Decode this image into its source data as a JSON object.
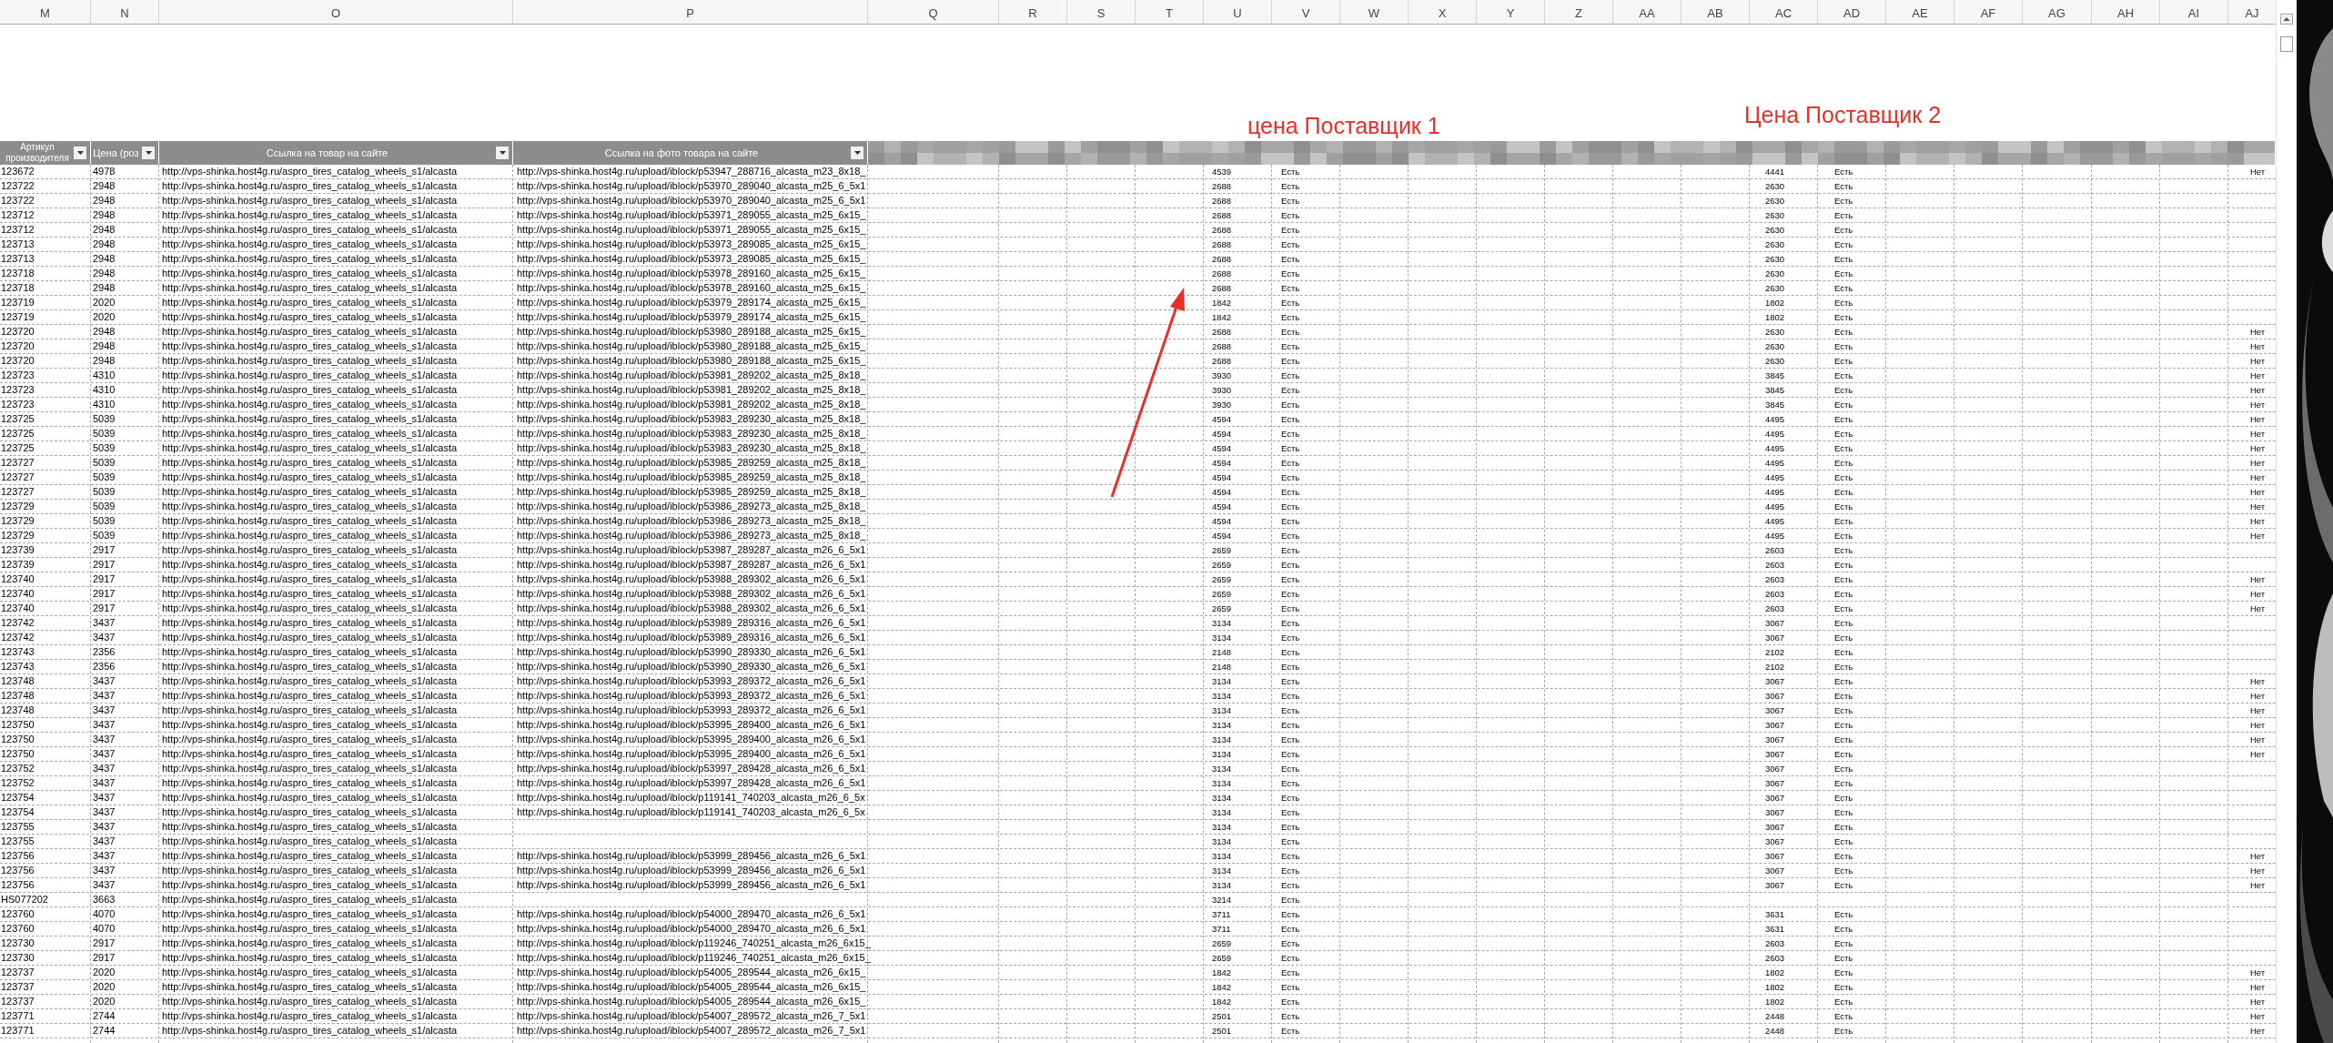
{
  "column_letters": [
    "M",
    "N",
    "O",
    "P",
    "Q",
    "R",
    "S",
    "T",
    "U",
    "V",
    "W",
    "X",
    "Y",
    "Z",
    "AA",
    "AB",
    "AC",
    "AD",
    "AE",
    "AF",
    "AG",
    "AH",
    "AI",
    "AJ"
  ],
  "annotations": [
    {
      "text": "цена Поставщик 1"
    },
    {
      "text": "Цена Поставщик 2"
    }
  ],
  "column_headers": [
    {
      "label": "Артикул производителя"
    },
    {
      "label": "Цена (роз"
    },
    {
      "label": "Ссылка на товар на сайте"
    },
    {
      "label": "Ссылка на фото товара на сайте"
    }
  ],
  "rows": [
    {
      "article": "123672",
      "retail_price": "4978",
      "product_url": "http://vps-shinka.host4g.ru/aspro_tires_catalog_wheels_s1/alcasta",
      "photo_url": "http://vps-shinka.host4g.ru/upload/iblock/p53947_288716_alcasta_m23_8x18_",
      "supplier1_price": "4539",
      "supplier1_stock": "Есть",
      "supplier2_price": "4441",
      "supplier2_stock": "Есть",
      "column_aj": "Нет"
    },
    {
      "article": "123722",
      "retail_price": "2948",
      "product_url": "http://vps-shinka.host4g.ru/aspro_tires_catalog_wheels_s1/alcasta",
      "photo_url": "http://vps-shinka.host4g.ru/upload/iblock/p53970_289040_alcasta_m25_6_5x1",
      "supplier1_price": "2688",
      "supplier1_stock": "Есть",
      "supplier2_price": "2630",
      "supplier2_stock": "Есть"
    },
    {
      "article": "123722",
      "retail_price": "2948",
      "product_url": "http://vps-shinka.host4g.ru/aspro_tires_catalog_wheels_s1/alcasta",
      "photo_url": "http://vps-shinka.host4g.ru/upload/iblock/p53970_289040_alcasta_m25_6_5x1",
      "supplier1_price": "2688",
      "supplier1_stock": "Есть",
      "supplier2_price": "2630",
      "supplier2_stock": "Есть"
    },
    {
      "article": "123712",
      "retail_price": "2948",
      "product_url": "http://vps-shinka.host4g.ru/aspro_tires_catalog_wheels_s1/alcasta",
      "photo_url": "http://vps-shinka.host4g.ru/upload/iblock/p53971_289055_alcasta_m25_6x15_",
      "supplier1_price": "2688",
      "supplier1_stock": "Есть",
      "supplier2_price": "2630",
      "supplier2_stock": "Есть"
    },
    {
      "article": "123712",
      "retail_price": "2948",
      "product_url": "http://vps-shinka.host4g.ru/aspro_tires_catalog_wheels_s1/alcasta",
      "photo_url": "http://vps-shinka.host4g.ru/upload/iblock/p53971_289055_alcasta_m25_6x15_",
      "supplier1_price": "2688",
      "supplier1_stock": "Есть",
      "supplier2_price": "2630",
      "supplier2_stock": "Есть"
    },
    {
      "article": "123713",
      "retail_price": "2948",
      "product_url": "http://vps-shinka.host4g.ru/aspro_tires_catalog_wheels_s1/alcasta",
      "photo_url": "http://vps-shinka.host4g.ru/upload/iblock/p53973_289085_alcasta_m25_6x15_",
      "supplier1_price": "2688",
      "supplier1_stock": "Есть",
      "supplier2_price": "2630",
      "supplier2_stock": "Есть"
    },
    {
      "article": "123713",
      "retail_price": "2948",
      "product_url": "http://vps-shinka.host4g.ru/aspro_tires_catalog_wheels_s1/alcasta",
      "photo_url": "http://vps-shinka.host4g.ru/upload/iblock/p53973_289085_alcasta_m25_6x15_",
      "supplier1_price": "2688",
      "supplier1_stock": "Есть",
      "supplier2_price": "2630",
      "supplier2_stock": "Есть"
    },
    {
      "article": "123718",
      "retail_price": "2948",
      "product_url": "http://vps-shinka.host4g.ru/aspro_tires_catalog_wheels_s1/alcasta",
      "photo_url": "http://vps-shinka.host4g.ru/upload/iblock/p53978_289160_alcasta_m25_6x15_",
      "supplier1_price": "2688",
      "supplier1_stock": "Есть",
      "supplier2_price": "2630",
      "supplier2_stock": "Есть"
    },
    {
      "article": "123718",
      "retail_price": "2948",
      "product_url": "http://vps-shinka.host4g.ru/aspro_tires_catalog_wheels_s1/alcasta",
      "photo_url": "http://vps-shinka.host4g.ru/upload/iblock/p53978_289160_alcasta_m25_6x15_",
      "supplier1_price": "2688",
      "supplier1_stock": "Есть",
      "supplier2_price": "2630",
      "supplier2_stock": "Есть"
    },
    {
      "article": "123719",
      "retail_price": "2020",
      "product_url": "http://vps-shinka.host4g.ru/aspro_tires_catalog_wheels_s1/alcasta",
      "photo_url": "http://vps-shinka.host4g.ru/upload/iblock/p53979_289174_alcasta_m25_6x15_",
      "supplier1_price": "1842",
      "supplier1_stock": "Есть",
      "supplier2_price": "1802",
      "supplier2_stock": "Есть"
    },
    {
      "article": "123719",
      "retail_price": "2020",
      "product_url": "http://vps-shinka.host4g.ru/aspro_tires_catalog_wheels_s1/alcasta",
      "photo_url": "http://vps-shinka.host4g.ru/upload/iblock/p53979_289174_alcasta_m25_6x15_",
      "supplier1_price": "1842",
      "supplier1_stock": "Есть",
      "supplier2_price": "1802",
      "supplier2_stock": "Есть"
    },
    {
      "article": "123720",
      "retail_price": "2948",
      "product_url": "http://vps-shinka.host4g.ru/aspro_tires_catalog_wheels_s1/alcasta",
      "photo_url": "http://vps-shinka.host4g.ru/upload/iblock/p53980_289188_alcasta_m25_6x15_",
      "supplier1_price": "2688",
      "supplier1_stock": "Есть",
      "supplier2_price": "2630",
      "supplier2_stock": "Есть",
      "column_aj": "Нет"
    },
    {
      "article": "123720",
      "retail_price": "2948",
      "product_url": "http://vps-shinka.host4g.ru/aspro_tires_catalog_wheels_s1/alcasta",
      "photo_url": "http://vps-shinka.host4g.ru/upload/iblock/p53980_289188_alcasta_m25_6x15_",
      "supplier1_price": "2688",
      "supplier1_stock": "Есть",
      "supplier2_price": "2630",
      "supplier2_stock": "Есть",
      "column_aj": "Нет"
    },
    {
      "article": "123720",
      "retail_price": "2948",
      "product_url": "http://vps-shinka.host4g.ru/aspro_tires_catalog_wheels_s1/alcasta",
      "photo_url": "http://vps-shinka.host4g.ru/upload/iblock/p53980_289188_alcasta_m25_6x15_",
      "supplier1_price": "2688",
      "supplier1_stock": "Есть",
      "supplier2_price": "2630",
      "supplier2_stock": "Есть",
      "column_aj": "Нет"
    },
    {
      "article": "123723",
      "retail_price": "4310",
      "product_url": "http://vps-shinka.host4g.ru/aspro_tires_catalog_wheels_s1/alcasta",
      "photo_url": "http://vps-shinka.host4g.ru/upload/iblock/p53981_289202_alcasta_m25_8x18_",
      "supplier1_price": "3930",
      "supplier1_stock": "Есть",
      "supplier2_price": "3845",
      "supplier2_stock": "Есть",
      "column_aj": "Нет"
    },
    {
      "article": "123723",
      "retail_price": "4310",
      "product_url": "http://vps-shinka.host4g.ru/aspro_tires_catalog_wheels_s1/alcasta",
      "photo_url": "http://vps-shinka.host4g.ru/upload/iblock/p53981_289202_alcasta_m25_8x18_",
      "supplier1_price": "3930",
      "supplier1_stock": "Есть",
      "supplier2_price": "3845",
      "supplier2_stock": "Есть",
      "column_aj": "Нет"
    },
    {
      "article": "123723",
      "retail_price": "4310",
      "product_url": "http://vps-shinka.host4g.ru/aspro_tires_catalog_wheels_s1/alcasta",
      "photo_url": "http://vps-shinka.host4g.ru/upload/iblock/p53981_289202_alcasta_m25_8x18_",
      "supplier1_price": "3930",
      "supplier1_stock": "Есть",
      "supplier2_price": "3845",
      "supplier2_stock": "Есть",
      "column_aj": "Нет"
    },
    {
      "article": "123725",
      "retail_price": "5039",
      "product_url": "http://vps-shinka.host4g.ru/aspro_tires_catalog_wheels_s1/alcasta",
      "photo_url": "http://vps-shinka.host4g.ru/upload/iblock/p53983_289230_alcasta_m25_8x18_",
      "supplier1_price": "4594",
      "supplier1_stock": "Есть",
      "supplier2_price": "4495",
      "supplier2_stock": "Есть",
      "column_aj": "Нет"
    },
    {
      "article": "123725",
      "retail_price": "5039",
      "product_url": "http://vps-shinka.host4g.ru/aspro_tires_catalog_wheels_s1/alcasta",
      "photo_url": "http://vps-shinka.host4g.ru/upload/iblock/p53983_289230_alcasta_m25_8x18_",
      "supplier1_price": "4594",
      "supplier1_stock": "Есть",
      "supplier2_price": "4495",
      "supplier2_stock": "Есть",
      "column_aj": "Нет"
    },
    {
      "article": "123725",
      "retail_price": "5039",
      "product_url": "http://vps-shinka.host4g.ru/aspro_tires_catalog_wheels_s1/alcasta",
      "photo_url": "http://vps-shinka.host4g.ru/upload/iblock/p53983_289230_alcasta_m25_8x18_",
      "supplier1_price": "4594",
      "supplier1_stock": "Есть",
      "supplier2_price": "4495",
      "supplier2_stock": "Есть",
      "column_aj": "Нет"
    },
    {
      "article": "123727",
      "retail_price": "5039",
      "product_url": "http://vps-shinka.host4g.ru/aspro_tires_catalog_wheels_s1/alcasta",
      "photo_url": "http://vps-shinka.host4g.ru/upload/iblock/p53985_289259_alcasta_m25_8x18_",
      "supplier1_price": "4594",
      "supplier1_stock": "Есть",
      "supplier2_price": "4495",
      "supplier2_stock": "Есть",
      "column_aj": "Нет"
    },
    {
      "article": "123727",
      "retail_price": "5039",
      "product_url": "http://vps-shinka.host4g.ru/aspro_tires_catalog_wheels_s1/alcasta",
      "photo_url": "http://vps-shinka.host4g.ru/upload/iblock/p53985_289259_alcasta_m25_8x18_",
      "supplier1_price": "4594",
      "supplier1_stock": "Есть",
      "supplier2_price": "4495",
      "supplier2_stock": "Есть",
      "column_aj": "Нет"
    },
    {
      "article": "123727",
      "retail_price": "5039",
      "product_url": "http://vps-shinka.host4g.ru/aspro_tires_catalog_wheels_s1/alcasta",
      "photo_url": "http://vps-shinka.host4g.ru/upload/iblock/p53985_289259_alcasta_m25_8x18_",
      "supplier1_price": "4594",
      "supplier1_stock": "Есть",
      "supplier2_price": "4495",
      "supplier2_stock": "Есть",
      "column_aj": "Нет"
    },
    {
      "article": "123729",
      "retail_price": "5039",
      "product_url": "http://vps-shinka.host4g.ru/aspro_tires_catalog_wheels_s1/alcasta",
      "photo_url": "http://vps-shinka.host4g.ru/upload/iblock/p53986_289273_alcasta_m25_8x18_",
      "supplier1_price": "4594",
      "supplier1_stock": "Есть",
      "supplier2_price": "4495",
      "supplier2_stock": "Есть",
      "column_aj": "Нет"
    },
    {
      "article": "123729",
      "retail_price": "5039",
      "product_url": "http://vps-shinka.host4g.ru/aspro_tires_catalog_wheels_s1/alcasta",
      "photo_url": "http://vps-shinka.host4g.ru/upload/iblock/p53986_289273_alcasta_m25_8x18_",
      "supplier1_price": "4594",
      "supplier1_stock": "Есть",
      "supplier2_price": "4495",
      "supplier2_stock": "Есть",
      "column_aj": "Нет"
    },
    {
      "article": "123729",
      "retail_price": "5039",
      "product_url": "http://vps-shinka.host4g.ru/aspro_tires_catalog_wheels_s1/alcasta",
      "photo_url": "http://vps-shinka.host4g.ru/upload/iblock/p53986_289273_alcasta_m25_8x18_",
      "supplier1_price": "4594",
      "supplier1_stock": "Есть",
      "supplier2_price": "4495",
      "supplier2_stock": "Есть",
      "column_aj": "Нет"
    },
    {
      "article": "123739",
      "retail_price": "2917",
      "product_url": "http://vps-shinka.host4g.ru/aspro_tires_catalog_wheels_s1/alcasta",
      "photo_url": "http://vps-shinka.host4g.ru/upload/iblock/p53987_289287_alcasta_m26_6_5x1",
      "supplier1_price": "2659",
      "supplier1_stock": "Есть",
      "supplier2_price": "2603",
      "supplier2_stock": "Есть"
    },
    {
      "article": "123739",
      "retail_price": "2917",
      "product_url": "http://vps-shinka.host4g.ru/aspro_tires_catalog_wheels_s1/alcasta",
      "photo_url": "http://vps-shinka.host4g.ru/upload/iblock/p53987_289287_alcasta_m26_6_5x1",
      "supplier1_price": "2659",
      "supplier1_stock": "Есть",
      "supplier2_price": "2603",
      "supplier2_stock": "Есть"
    },
    {
      "article": "123740",
      "retail_price": "2917",
      "product_url": "http://vps-shinka.host4g.ru/aspro_tires_catalog_wheels_s1/alcasta",
      "photo_url": "http://vps-shinka.host4g.ru/upload/iblock/p53988_289302_alcasta_m26_6_5x1",
      "supplier1_price": "2659",
      "supplier1_stock": "Есть",
      "supplier2_price": "2603",
      "supplier2_stock": "Есть",
      "column_aj": "Нет"
    },
    {
      "article": "123740",
      "retail_price": "2917",
      "product_url": "http://vps-shinka.host4g.ru/aspro_tires_catalog_wheels_s1/alcasta",
      "photo_url": "http://vps-shinka.host4g.ru/upload/iblock/p53988_289302_alcasta_m26_6_5x1",
      "supplier1_price": "2659",
      "supplier1_stock": "Есть",
      "supplier2_price": "2603",
      "supplier2_stock": "Есть",
      "column_aj": "Нет"
    },
    {
      "article": "123740",
      "retail_price": "2917",
      "product_url": "http://vps-shinka.host4g.ru/aspro_tires_catalog_wheels_s1/alcasta",
      "photo_url": "http://vps-shinka.host4g.ru/upload/iblock/p53988_289302_alcasta_m26_6_5x1",
      "supplier1_price": "2659",
      "supplier1_stock": "Есть",
      "supplier2_price": "2603",
      "supplier2_stock": "Есть",
      "column_aj": "Нет"
    },
    {
      "article": "123742",
      "retail_price": "3437",
      "product_url": "http://vps-shinka.host4g.ru/aspro_tires_catalog_wheels_s1/alcasta",
      "photo_url": "http://vps-shinka.host4g.ru/upload/iblock/p53989_289316_alcasta_m26_6_5x1",
      "supplier1_price": "3134",
      "supplier1_stock": "Есть",
      "supplier2_price": "3067",
      "supplier2_stock": "Есть"
    },
    {
      "article": "123742",
      "retail_price": "3437",
      "product_url": "http://vps-shinka.host4g.ru/aspro_tires_catalog_wheels_s1/alcasta",
      "photo_url": "http://vps-shinka.host4g.ru/upload/iblock/p53989_289316_alcasta_m26_6_5x1",
      "supplier1_price": "3134",
      "supplier1_stock": "Есть",
      "supplier2_price": "3067",
      "supplier2_stock": "Есть"
    },
    {
      "article": "123743",
      "retail_price": "2356",
      "product_url": "http://vps-shinka.host4g.ru/aspro_tires_catalog_wheels_s1/alcasta",
      "photo_url": "http://vps-shinka.host4g.ru/upload/iblock/p53990_289330_alcasta_m26_6_5x1",
      "supplier1_price": "2148",
      "supplier1_stock": "Есть",
      "supplier2_price": "2102",
      "supplier2_stock": "Есть"
    },
    {
      "article": "123743",
      "retail_price": "2356",
      "product_url": "http://vps-shinka.host4g.ru/aspro_tires_catalog_wheels_s1/alcasta",
      "photo_url": "http://vps-shinka.host4g.ru/upload/iblock/p53990_289330_alcasta_m26_6_5x1",
      "supplier1_price": "2148",
      "supplier1_stock": "Есть",
      "supplier2_price": "2102",
      "supplier2_stock": "Есть"
    },
    {
      "article": "123748",
      "retail_price": "3437",
      "product_url": "http://vps-shinka.host4g.ru/aspro_tires_catalog_wheels_s1/alcasta",
      "photo_url": "http://vps-shinka.host4g.ru/upload/iblock/p53993_289372_alcasta_m26_6_5x1",
      "supplier1_price": "3134",
      "supplier1_stock": "Есть",
      "supplier2_price": "3067",
      "supplier2_stock": "Есть",
      "column_aj": "Нет"
    },
    {
      "article": "123748",
      "retail_price": "3437",
      "product_url": "http://vps-shinka.host4g.ru/aspro_tires_catalog_wheels_s1/alcasta",
      "photo_url": "http://vps-shinka.host4g.ru/upload/iblock/p53993_289372_alcasta_m26_6_5x1",
      "supplier1_price": "3134",
      "supplier1_stock": "Есть",
      "supplier2_price": "3067",
      "supplier2_stock": "Есть",
      "column_aj": "Нет"
    },
    {
      "article": "123748",
      "retail_price": "3437",
      "product_url": "http://vps-shinka.host4g.ru/aspro_tires_catalog_wheels_s1/alcasta",
      "photo_url": "http://vps-shinka.host4g.ru/upload/iblock/p53993_289372_alcasta_m26_6_5x1",
      "supplier1_price": "3134",
      "supplier1_stock": "Есть",
      "supplier2_price": "3067",
      "supplier2_stock": "Есть",
      "column_aj": "Нет"
    },
    {
      "article": "123750",
      "retail_price": "3437",
      "product_url": "http://vps-shinka.host4g.ru/aspro_tires_catalog_wheels_s1/alcasta",
      "photo_url": "http://vps-shinka.host4g.ru/upload/iblock/p53995_289400_alcasta_m26_6_5x1",
      "supplier1_price": "3134",
      "supplier1_stock": "Есть",
      "supplier2_price": "3067",
      "supplier2_stock": "Есть",
      "column_aj": "Нет"
    },
    {
      "article": "123750",
      "retail_price": "3437",
      "product_url": "http://vps-shinka.host4g.ru/aspro_tires_catalog_wheels_s1/alcasta",
      "photo_url": "http://vps-shinka.host4g.ru/upload/iblock/p53995_289400_alcasta_m26_6_5x1",
      "supplier1_price": "3134",
      "supplier1_stock": "Есть",
      "supplier2_price": "3067",
      "supplier2_stock": "Есть",
      "column_aj": "Нет"
    },
    {
      "article": "123750",
      "retail_price": "3437",
      "product_url": "http://vps-shinka.host4g.ru/aspro_tires_catalog_wheels_s1/alcasta",
      "photo_url": "http://vps-shinka.host4g.ru/upload/iblock/p53995_289400_alcasta_m26_6_5x1",
      "supplier1_price": "3134",
      "supplier1_stock": "Есть",
      "supplier2_price": "3067",
      "supplier2_stock": "Есть",
      "column_aj": "Нет"
    },
    {
      "article": "123752",
      "retail_price": "3437",
      "product_url": "http://vps-shinka.host4g.ru/aspro_tires_catalog_wheels_s1/alcasta",
      "photo_url": "http://vps-shinka.host4g.ru/upload/iblock/p53997_289428_alcasta_m26_6_5x1",
      "supplier1_price": "3134",
      "supplier1_stock": "Есть",
      "supplier2_price": "3067",
      "supplier2_stock": "Есть"
    },
    {
      "article": "123752",
      "retail_price": "3437",
      "product_url": "http://vps-shinka.host4g.ru/aspro_tires_catalog_wheels_s1/alcasta",
      "photo_url": "http://vps-shinka.host4g.ru/upload/iblock/p53997_289428_alcasta_m26_6_5x1",
      "supplier1_price": "3134",
      "supplier1_stock": "Есть",
      "supplier2_price": "3067",
      "supplier2_stock": "Есть"
    },
    {
      "article": "123754",
      "retail_price": "3437",
      "product_url": "http://vps-shinka.host4g.ru/aspro_tires_catalog_wheels_s1/alcasta",
      "photo_url": "http://vps-shinka.host4g.ru/upload/iblock/p119141_740203_alcasta_m26_6_5x",
      "supplier1_price": "3134",
      "supplier1_stock": "Есть",
      "supplier2_price": "3067",
      "supplier2_stock": "Есть"
    },
    {
      "article": "123754",
      "retail_price": "3437",
      "product_url": "http://vps-shinka.host4g.ru/aspro_tires_catalog_wheels_s1/alcasta",
      "photo_url": "http://vps-shinka.host4g.ru/upload/iblock/p119141_740203_alcasta_m26_6_5x",
      "supplier1_price": "3134",
      "supplier1_stock": "Есть",
      "supplier2_price": "3067",
      "supplier2_stock": "Есть"
    },
    {
      "article": "123755",
      "retail_price": "3437",
      "product_url": "http://vps-shinka.host4g.ru/aspro_tires_catalog_wheels_s1/alcasta",
      "supplier1_price": "3134",
      "supplier1_stock": "Есть",
      "supplier2_price": "3067",
      "supplier2_stock": "Есть"
    },
    {
      "article": "123755",
      "retail_price": "3437",
      "product_url": "http://vps-shinka.host4g.ru/aspro_tires_catalog_wheels_s1/alcasta",
      "supplier1_price": "3134",
      "supplier1_stock": "Есть",
      "supplier2_price": "3067",
      "supplier2_stock": "Есть"
    },
    {
      "article": "123756",
      "retail_price": "3437",
      "product_url": "http://vps-shinka.host4g.ru/aspro_tires_catalog_wheels_s1/alcasta",
      "photo_url": "http://vps-shinka.host4g.ru/upload/iblock/p53999_289456_alcasta_m26_6_5x1",
      "supplier1_price": "3134",
      "supplier1_stock": "Есть",
      "supplier2_price": "3067",
      "supplier2_stock": "Есть",
      "column_aj": "Нет"
    },
    {
      "article": "123756",
      "retail_price": "3437",
      "product_url": "http://vps-shinka.host4g.ru/aspro_tires_catalog_wheels_s1/alcasta",
      "photo_url": "http://vps-shinka.host4g.ru/upload/iblock/p53999_289456_alcasta_m26_6_5x1",
      "supplier1_price": "3134",
      "supplier1_stock": "Есть",
      "supplier2_price": "3067",
      "supplier2_stock": "Есть",
      "column_aj": "Нет"
    },
    {
      "article": "123756",
      "retail_price": "3437",
      "product_url": "http://vps-shinka.host4g.ru/aspro_tires_catalog_wheels_s1/alcasta",
      "photo_url": "http://vps-shinka.host4g.ru/upload/iblock/p53999_289456_alcasta_m26_6_5x1",
      "supplier1_price": "3134",
      "supplier1_stock": "Есть",
      "supplier2_price": "3067",
      "supplier2_stock": "Есть",
      "column_aj": "Нет"
    },
    {
      "article": "HS077202",
      "retail_price": "3663",
      "product_url": "http://vps-shinka.host4g.ru/aspro_tires_catalog_wheels_s1/alcasta",
      "supplier1_price": "3214",
      "supplier1_stock": "Есть"
    },
    {
      "article": "123760",
      "retail_price": "4070",
      "product_url": "http://vps-shinka.host4g.ru/aspro_tires_catalog_wheels_s1/alcasta",
      "photo_url": "http://vps-shinka.host4g.ru/upload/iblock/p54000_289470_alcasta_m26_6_5x1",
      "supplier1_price": "3711",
      "supplier1_stock": "Есть",
      "supplier2_price": "3631",
      "supplier2_stock": "Есть"
    },
    {
      "article": "123760",
      "retail_price": "4070",
      "product_url": "http://vps-shinka.host4g.ru/aspro_tires_catalog_wheels_s1/alcasta",
      "photo_url": "http://vps-shinka.host4g.ru/upload/iblock/p54000_289470_alcasta_m26_6_5x1",
      "supplier1_price": "3711",
      "supplier1_stock": "Есть",
      "supplier2_price": "3631",
      "supplier2_stock": "Есть"
    },
    {
      "article": "123730",
      "retail_price": "2917",
      "product_url": "http://vps-shinka.host4g.ru/aspro_tires_catalog_wheels_s1/alcasta",
      "photo_url": "http://vps-shinka.host4g.ru/upload/iblock/p119246_740251_alcasta_m26_6x15_",
      "supplier1_price": "2659",
      "supplier1_stock": "Есть",
      "supplier2_price": "2603",
      "supplier2_stock": "Есть"
    },
    {
      "article": "123730",
      "retail_price": "2917",
      "product_url": "http://vps-shinka.host4g.ru/aspro_tires_catalog_wheels_s1/alcasta",
      "photo_url": "http://vps-shinka.host4g.ru/upload/iblock/p119246_740251_alcasta_m26_6x15_",
      "supplier1_price": "2659",
      "supplier1_stock": "Есть",
      "supplier2_price": "2603",
      "supplier2_stock": "Есть"
    },
    {
      "article": "123737",
      "retail_price": "2020",
      "product_url": "http://vps-shinka.host4g.ru/aspro_tires_catalog_wheels_s1/alcasta",
      "photo_url": "http://vps-shinka.host4g.ru/upload/iblock/p54005_289544_alcasta_m26_6x15_",
      "supplier1_price": "1842",
      "supplier1_stock": "Есть",
      "supplier2_price": "1802",
      "supplier2_stock": "Есть",
      "column_aj": "Нет"
    },
    {
      "article": "123737",
      "retail_price": "2020",
      "product_url": "http://vps-shinka.host4g.ru/aspro_tires_catalog_wheels_s1/alcasta",
      "photo_url": "http://vps-shinka.host4g.ru/upload/iblock/p54005_289544_alcasta_m26_6x15_",
      "supplier1_price": "1842",
      "supplier1_stock": "Есть",
      "supplier2_price": "1802",
      "supplier2_stock": "Есть",
      "column_aj": "Нет"
    },
    {
      "article": "123737",
      "retail_price": "2020",
      "product_url": "http://vps-shinka.host4g.ru/aspro_tires_catalog_wheels_s1/alcasta",
      "photo_url": "http://vps-shinka.host4g.ru/upload/iblock/p54005_289544_alcasta_m26_6x15_",
      "supplier1_price": "1842",
      "supplier1_stock": "Есть",
      "supplier2_price": "1802",
      "supplier2_stock": "Есть",
      "column_aj": "Нет"
    },
    {
      "article": "123771",
      "retail_price": "2744",
      "product_url": "http://vps-shinka.host4g.ru/aspro_tires_catalog_wheels_s1/alcasta",
      "photo_url": "http://vps-shinka.host4g.ru/upload/iblock/p54007_289572_alcasta_m26_7_5x1",
      "supplier1_price": "2501",
      "supplier1_stock": "Есть",
      "supplier2_price": "2448",
      "supplier2_stock": "Есть",
      "column_aj": "Нет"
    },
    {
      "article": "123771",
      "retail_price": "2744",
      "product_url": "http://vps-shinka.host4g.ru/aspro_tires_catalog_wheels_s1/alcasta",
      "photo_url": "http://vps-shinka.host4g.ru/upload/iblock/p54007_289572_alcasta_m26_7_5x1",
      "supplier1_price": "2501",
      "supplier1_stock": "Есть",
      "supplier2_price": "2448",
      "supplier2_stock": "Есть",
      "column_aj": "Нет"
    }
  ]
}
